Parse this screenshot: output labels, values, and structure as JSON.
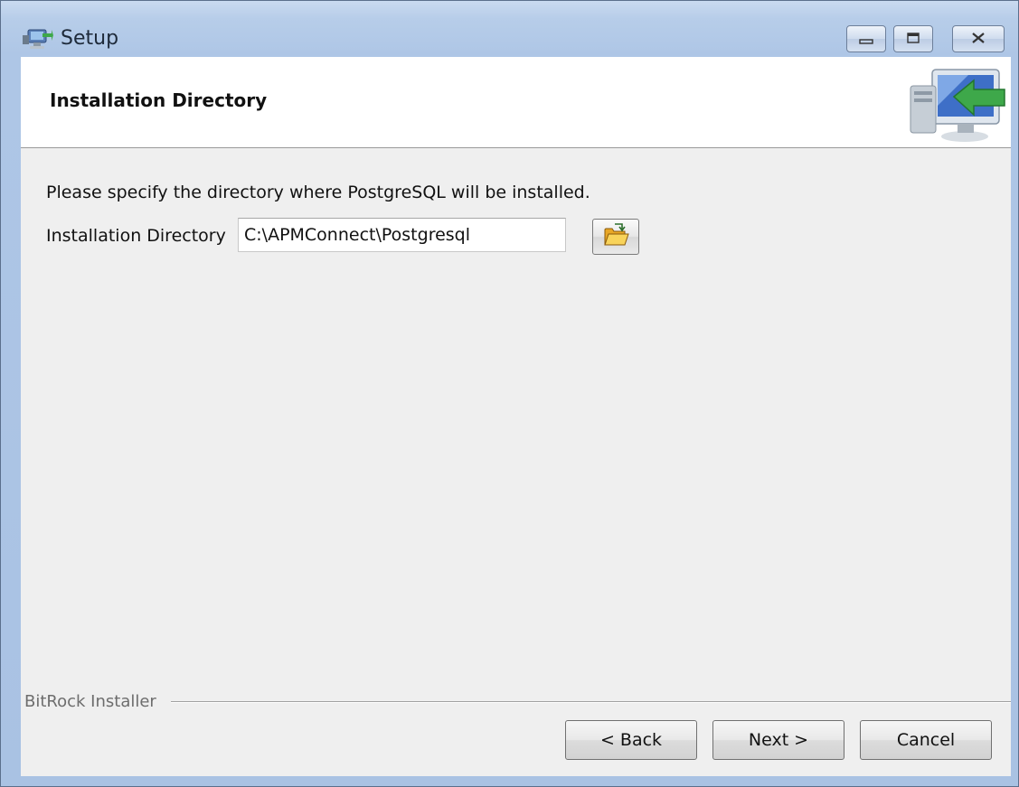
{
  "window": {
    "title": "Setup",
    "icon": "installer-app-icon",
    "controls": {
      "minimize": "minimize-icon",
      "maximize": "maximize-icon",
      "close": "close-icon"
    }
  },
  "header": {
    "title": "Installation Directory",
    "icon": "computer-install-icon"
  },
  "main": {
    "instruction": "Please specify the directory where PostgreSQL will be installed.",
    "directory_label": "Installation Directory",
    "directory_value": "C:\\APMConnect\\Postgresql",
    "browse_icon": "open-folder-icon"
  },
  "footer": {
    "group_label": "BitRock Installer",
    "back_label": "< Back",
    "next_label": "Next >",
    "cancel_label": "Cancel"
  },
  "colors": {
    "titlebar": "#b7cde9",
    "header_bg": "#ffffff",
    "body_bg": "#efefef",
    "arrow_green": "#3ea84a"
  }
}
